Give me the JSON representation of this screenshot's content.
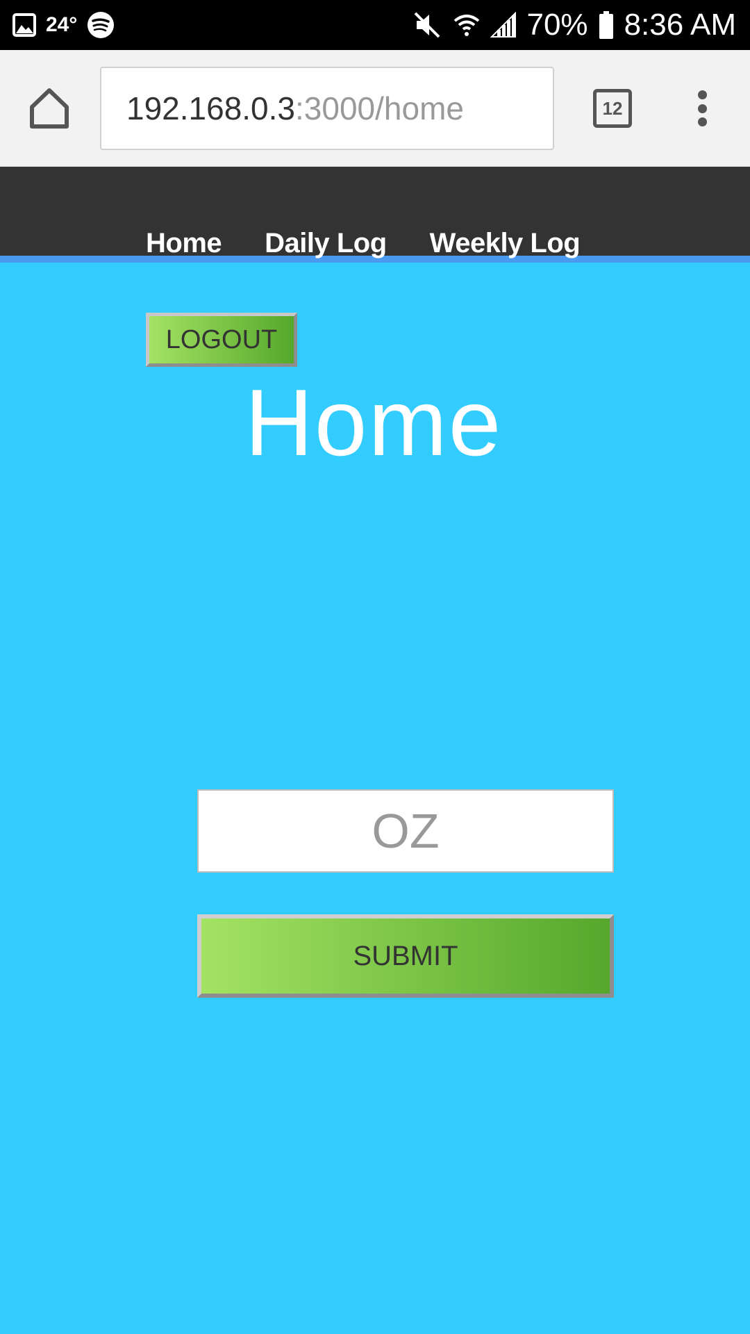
{
  "status_bar": {
    "temperature": "24°",
    "battery": "70%",
    "time": "8:36 AM",
    "icons": [
      "gallery-icon",
      "spotify-icon",
      "mute-icon",
      "wifi-icon",
      "signal-icon",
      "battery-icon"
    ]
  },
  "browser": {
    "url_host": "192.168.0.3",
    "url_path": ":3000/home",
    "tab_count": "12"
  },
  "nav": {
    "items": [
      {
        "label": "Home"
      },
      {
        "label": "Daily Log"
      },
      {
        "label": "Weekly Log"
      }
    ]
  },
  "page": {
    "logout_label": "LOGOUT",
    "title": "Home",
    "oz_placeholder": "OZ",
    "submit_label": "SUBMIT"
  },
  "colors": {
    "background": "#33ccff",
    "nav_bg": "#333333",
    "nav_underline": "#4a9af0",
    "button_gradient_start": "#a4e263",
    "button_gradient_end": "#55a82c"
  }
}
